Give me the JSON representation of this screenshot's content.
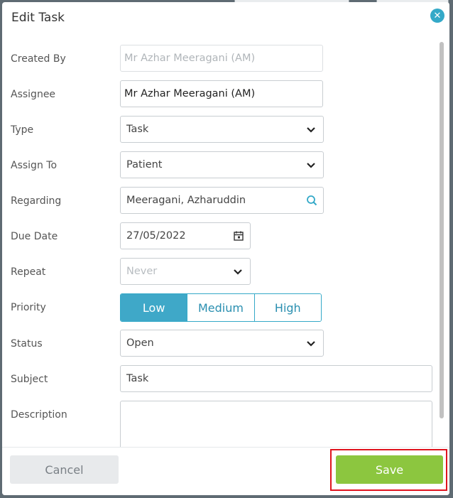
{
  "dialog": {
    "title": "Edit Task",
    "close_icon": "close-icon"
  },
  "form": {
    "created_by": {
      "label": "Created By",
      "value": "Mr Azhar Meeragani (AM)"
    },
    "assignee": {
      "label": "Assignee",
      "value": "Mr Azhar Meeragani (AM)"
    },
    "type": {
      "label": "Type",
      "value": "Task"
    },
    "assign_to": {
      "label": "Assign To",
      "value": "Patient"
    },
    "regarding": {
      "label": "Regarding",
      "value": "Meeragani, Azharuddin",
      "icon": "search-icon"
    },
    "due_date": {
      "label": "Due Date",
      "value": "27/05/2022",
      "icon": "calendar-icon"
    },
    "repeat": {
      "label": "Repeat",
      "value": "Never"
    },
    "priority": {
      "label": "Priority",
      "options": [
        "Low",
        "Medium",
        "High"
      ],
      "selected": "Low"
    },
    "status": {
      "label": "Status",
      "value": "Open"
    },
    "subject": {
      "label": "Subject",
      "value": "Task"
    },
    "description": {
      "label": "Description",
      "value": ""
    }
  },
  "footer": {
    "cancel_label": "Cancel",
    "save_label": "Save"
  },
  "colors": {
    "accent": "#34a9c8",
    "save": "#8cc63f",
    "highlight": "#e0141e"
  }
}
